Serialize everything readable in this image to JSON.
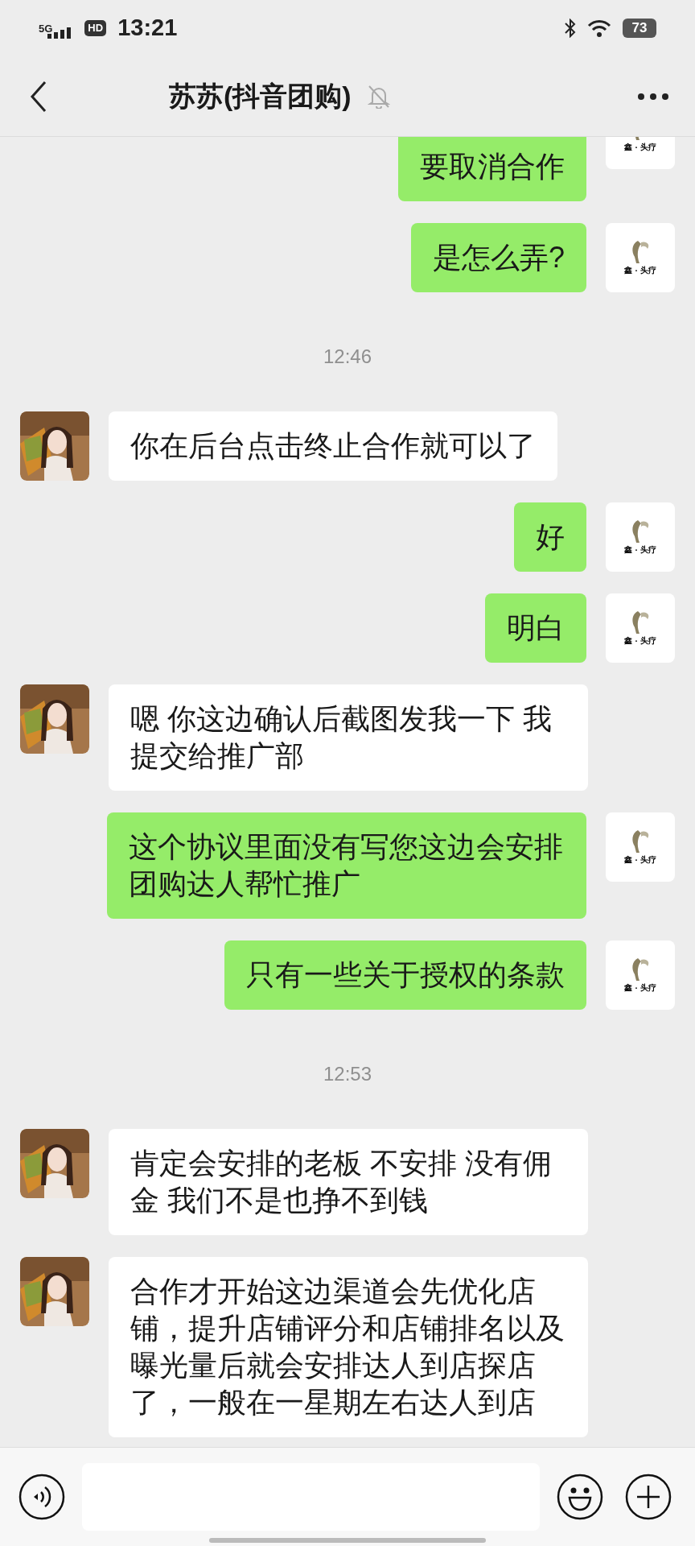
{
  "status_bar": {
    "network": "5G",
    "hd": "HD",
    "time": "13:21",
    "battery": "73"
  },
  "header": {
    "title": "苏苏(抖音团购)"
  },
  "messages": [
    {
      "kind": "sent",
      "text": "要取消合作",
      "avatar_label": "鑫 · 头疗"
    },
    {
      "kind": "sent",
      "text": "是怎么弄?",
      "avatar_label": "鑫 · 头疗"
    },
    {
      "kind": "time",
      "text": "12:46"
    },
    {
      "kind": "received",
      "text": "你在后台点击终止合作就可以了"
    },
    {
      "kind": "sent",
      "text": "好",
      "avatar_label": "鑫 · 头疗"
    },
    {
      "kind": "sent",
      "text": "明白",
      "avatar_label": "鑫 · 头疗"
    },
    {
      "kind": "received",
      "text": "嗯 你这边确认后截图发我一下 我提交给推广部"
    },
    {
      "kind": "sent",
      "text": "这个协议里面没有写您这边会安排团购达人帮忙推广",
      "avatar_label": "鑫 · 头疗"
    },
    {
      "kind": "sent",
      "text": "只有一些关于授权的条款",
      "avatar_label": "鑫 · 头疗"
    },
    {
      "kind": "time",
      "text": "12:53"
    },
    {
      "kind": "received",
      "text": "肯定会安排的老板 不安排 没有佣金 我们不是也挣不到钱"
    },
    {
      "kind": "received",
      "text": "合作才开始这边渠道会先优化店铺，提升店铺评分和店铺排名以及曝光量后就会安排达人到店探店了，一般在一星期左右达人到店"
    }
  ]
}
